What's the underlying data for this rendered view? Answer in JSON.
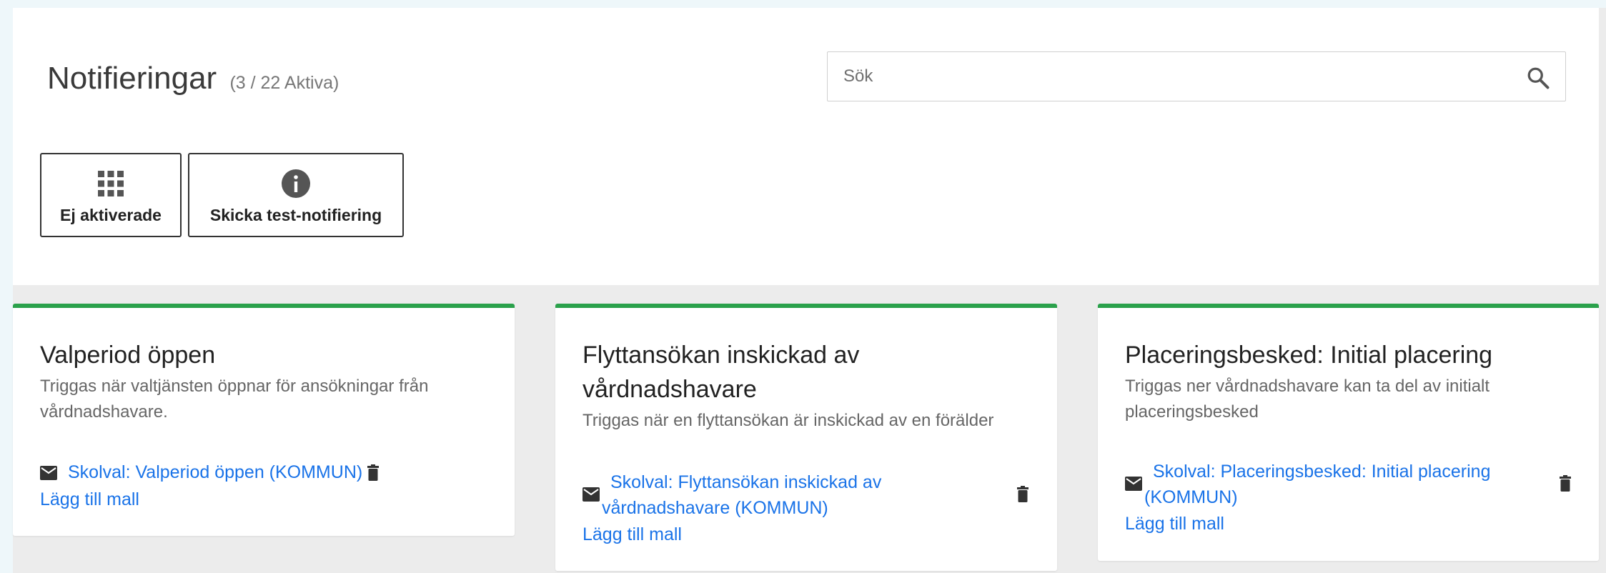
{
  "header": {
    "title": "Notifieringar",
    "count": "(3 / 22 Aktiva)"
  },
  "search": {
    "placeholder": "Sök",
    "value": ""
  },
  "toolbar": {
    "not_activated_label": "Ej aktiverade",
    "send_test_label": "Skicka test-notifiering"
  },
  "cards": [
    {
      "title": "Valperiod öppen",
      "description": "Triggas när valtjänsten öppnar för ansökningar från vårdnadshavare.",
      "template": "Skolval: Valperiod öppen (KOMMUN)",
      "add_label": "Lägg till mall"
    },
    {
      "title": "Flyttansökan inskickad av vårdnadshavare",
      "description": "Triggas när en flyttansökan är inskickad av en förälder",
      "template": "Skolval: Flyttansökan inskickad av vårdnadshavare (KOMMUN)",
      "add_label": "Lägg till mall"
    },
    {
      "title": "Placeringsbesked: Initial placering",
      "description": "Triggas ner vårdnadshavare kan ta del av initialt placeringsbesked",
      "template": "Skolval: Placeringsbesked: Initial placering (KOMMUN)",
      "add_label": "Lägg till mall"
    }
  ],
  "colors": {
    "accent": "#2aa14b",
    "link": "#1a73e8"
  },
  "icons": [
    "search-icon",
    "grid-icon",
    "info-icon",
    "mail-icon",
    "trash-icon"
  ]
}
